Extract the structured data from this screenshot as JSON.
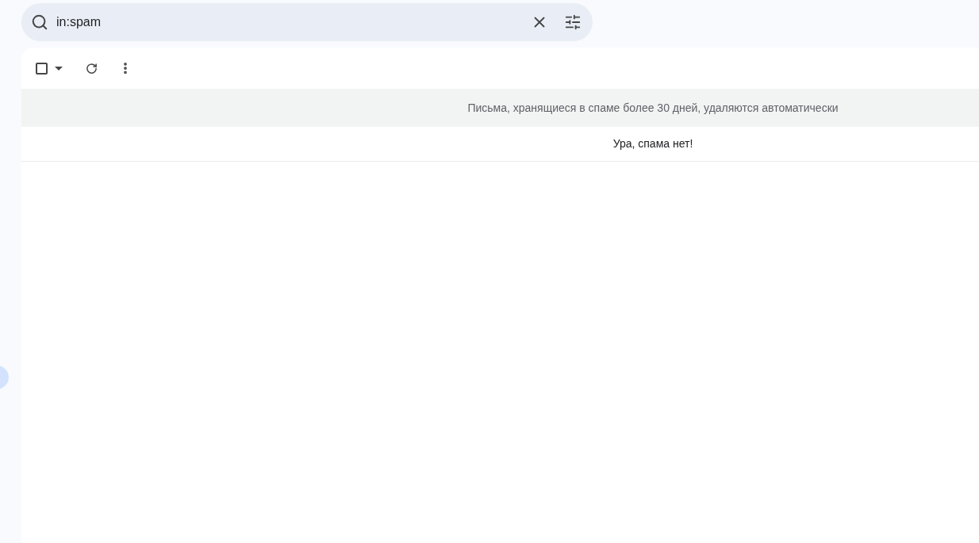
{
  "search": {
    "value": "in:spam"
  },
  "toolbar": {
    "select_all": {
      "checked": false
    }
  },
  "notice": "Письма, хранящиеся в спаме более 30 дней, удаляются автоматически",
  "empty_message": "Ура, спама нет!"
}
